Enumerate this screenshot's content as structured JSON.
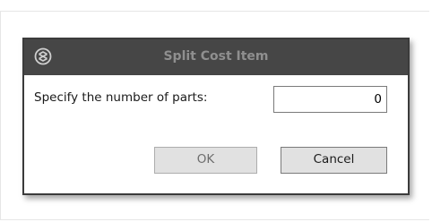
{
  "dialog": {
    "title": "Split Cost Item",
    "icon": "app-logo-icon",
    "prompt_label": "Specify the number of parts:",
    "parts_value": "0",
    "ok_label": "OK",
    "cancel_label": "Cancel"
  },
  "colors": {
    "titlebar_bg": "#464646",
    "title_text": "#8f8f8f",
    "dialog_border": "#3b3b3b",
    "button_bg": "#e1e1e1"
  }
}
